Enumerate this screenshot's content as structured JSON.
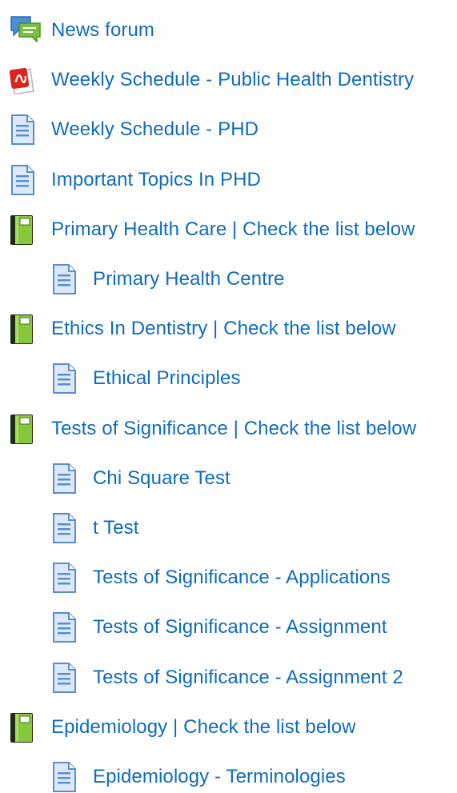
{
  "activities": [
    {
      "icon": "forum-icon",
      "label": "News forum",
      "level": 0
    },
    {
      "icon": "pdf-icon",
      "label": "Weekly Schedule - Public Health Dentistry",
      "level": 0
    },
    {
      "icon": "page-icon",
      "label": "Weekly Schedule - PHD",
      "level": 0
    },
    {
      "icon": "page-icon",
      "label": "Important Topics In PHD",
      "level": 0
    },
    {
      "icon": "book-icon",
      "label": "Primary Health Care | Check the list below",
      "level": 0
    },
    {
      "icon": "page-icon",
      "label": "Primary Health Centre",
      "level": 1
    },
    {
      "icon": "book-icon",
      "label": "Ethics In Dentistry | Check the list below",
      "level": 0
    },
    {
      "icon": "page-icon",
      "label": "Ethical Principles",
      "level": 1
    },
    {
      "icon": "book-icon",
      "label": "Tests of Significance | Check the list below",
      "level": 0
    },
    {
      "icon": "page-icon",
      "label": "Chi Square Test",
      "level": 1
    },
    {
      "icon": "page-icon",
      "label": "t Test",
      "level": 1
    },
    {
      "icon": "page-icon",
      "label": "Tests of Significance - Applications",
      "level": 1
    },
    {
      "icon": "page-icon",
      "label": "Tests of Significance - Assignment",
      "level": 1
    },
    {
      "icon": "page-icon",
      "label": "Tests of Significance - Assignment 2",
      "level": 1
    },
    {
      "icon": "book-icon",
      "label": "Epidemiology | Check the list below",
      "level": 0
    },
    {
      "icon": "page-icon",
      "label": "Epidemiology - Terminologies",
      "level": 1
    }
  ],
  "colors": {
    "link": "#0f6cbf",
    "page_icon_fill": "#dbe9fb",
    "page_icon_stroke": "#5a8ed0",
    "book_green": "#86c83b",
    "book_dark": "#1f2a12",
    "forum_blue": "#4a90d9",
    "forum_green": "#7ac142",
    "pdf_red": "#d9251d"
  }
}
